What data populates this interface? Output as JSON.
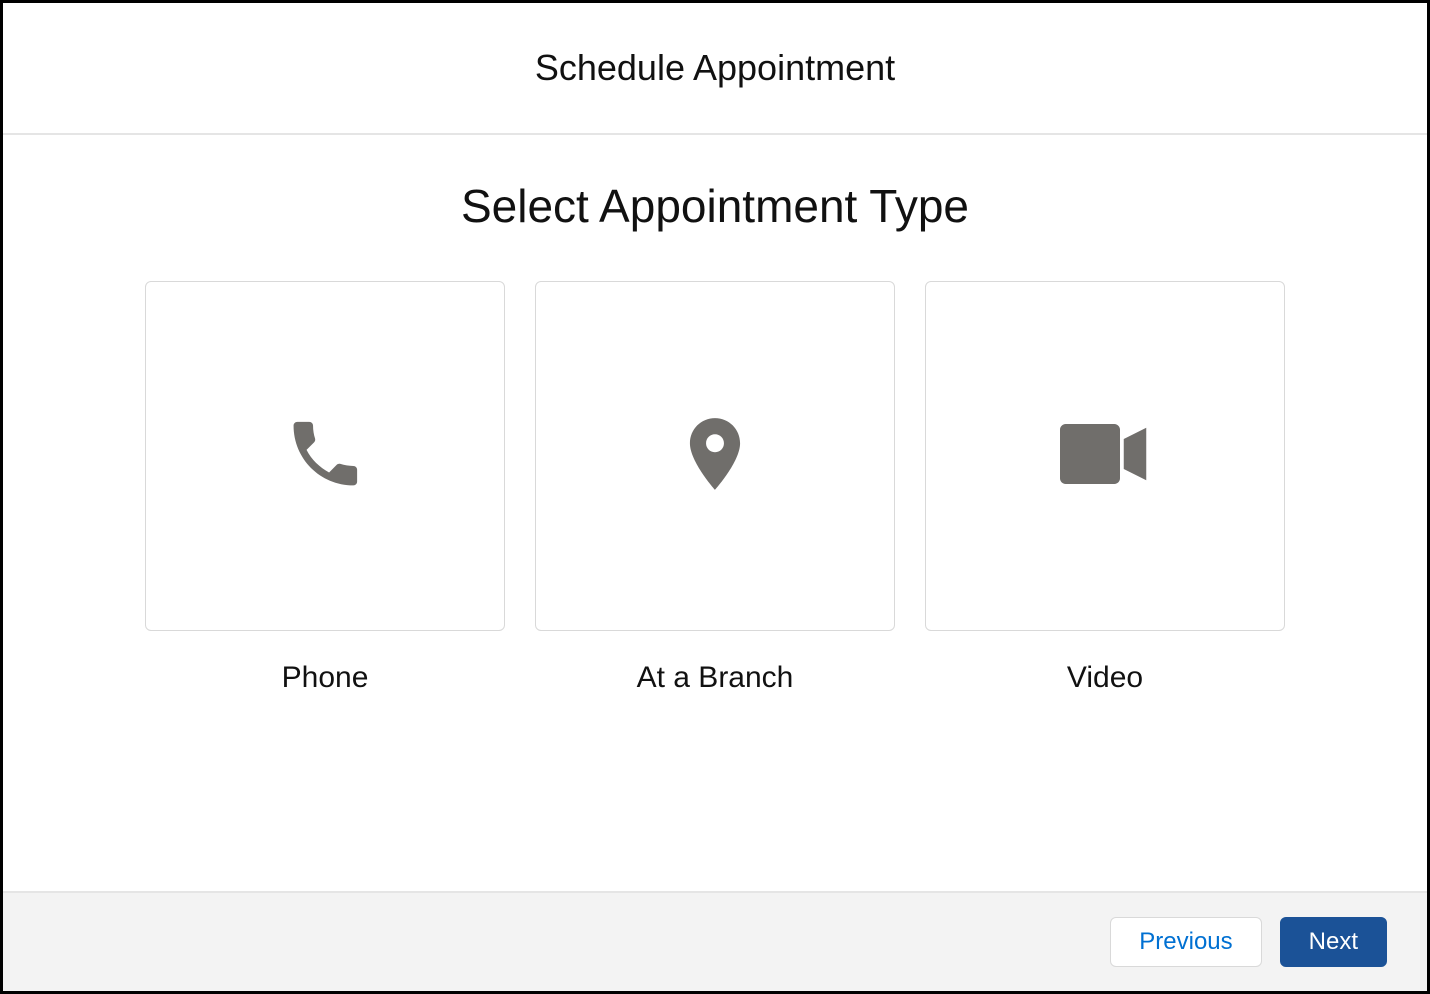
{
  "header": {
    "title": "Schedule Appointment"
  },
  "section": {
    "title": "Select Appointment Type"
  },
  "options": [
    {
      "label": "Phone",
      "icon": "phone-icon"
    },
    {
      "label": "At a Branch",
      "icon": "location-pin-icon"
    },
    {
      "label": "Video",
      "icon": "video-camera-icon"
    }
  ],
  "footer": {
    "previous_label": "Previous",
    "next_label": "Next"
  },
  "colors": {
    "icon": "#706e6b",
    "primary": "#1b5297",
    "link": "#0070d2",
    "border": "#d9d9d9",
    "footer_bg": "#f3f3f3"
  }
}
